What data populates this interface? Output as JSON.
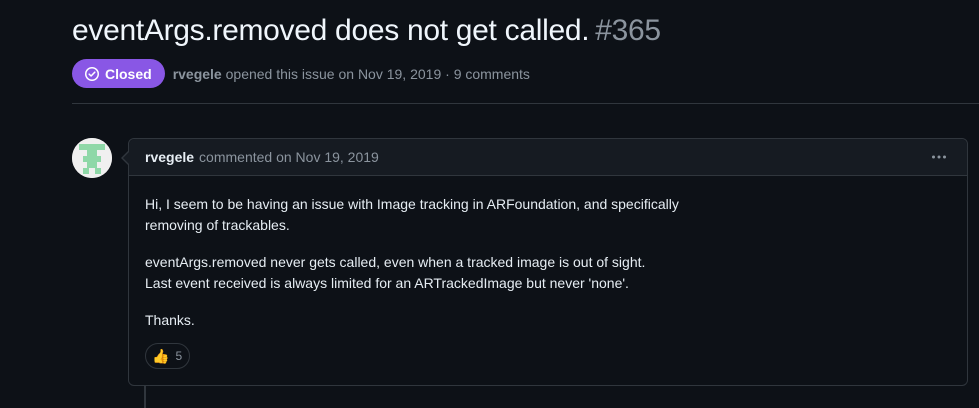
{
  "issue": {
    "title": "eventArgs.removed does not get called.",
    "number": "#365",
    "state": "Closed",
    "state_color": "#8957e5",
    "author": "rvegele",
    "opened_text": "opened this issue on Nov 19, 2019",
    "separator": "·",
    "comments_count": "9 comments"
  },
  "comment": {
    "author": "rvegele",
    "commented_text": "commented on Nov 19, 2019",
    "menu_icon": "kebab-horizontal-icon",
    "avatar_icon": "identicon-avatar",
    "paragraphs": [
      "Hi, I seem to be having an issue with Image tracking in ARFoundation, and specifically\nremoving of trackables.",
      "eventArgs.removed never gets called, even when a tracked image is out of sight.\nLast event received is always limited for an ARTrackedImage but never 'none'.",
      "Thanks."
    ],
    "reaction": {
      "emoji": "👍",
      "icon": "thumbs-up-icon",
      "count": "5"
    }
  }
}
